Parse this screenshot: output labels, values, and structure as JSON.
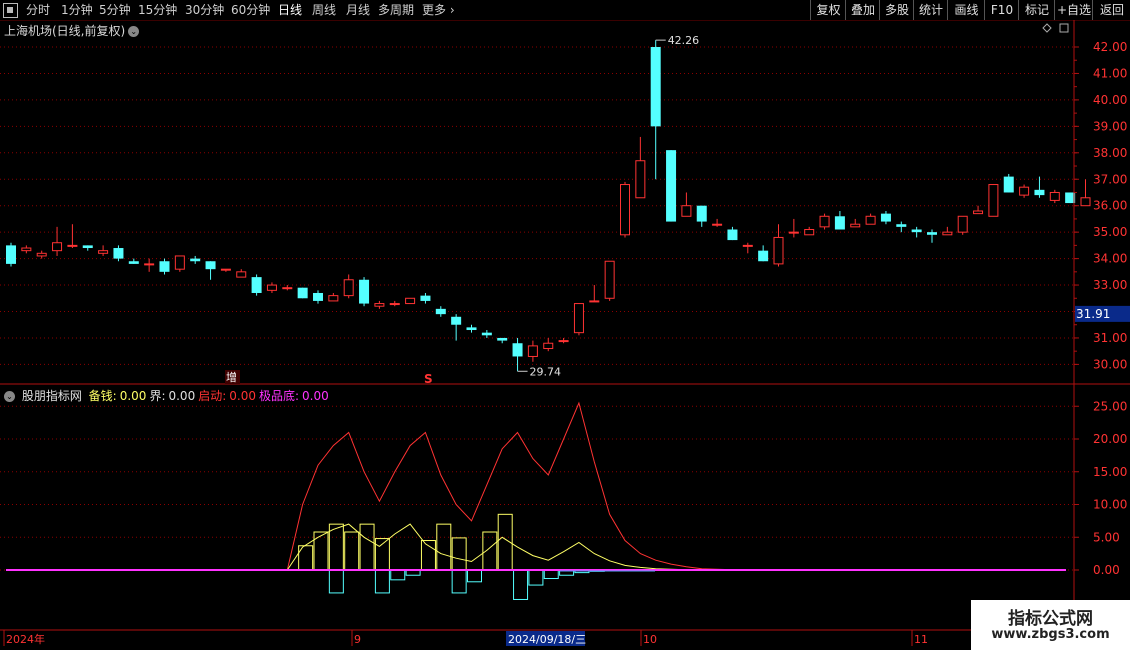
{
  "toolbar": {
    "periods": [
      "分时",
      "1分钟",
      "5分钟",
      "15分钟",
      "30分钟",
      "60分钟",
      "日线",
      "周线",
      "月线",
      "多周期",
      "更多"
    ],
    "active_period": "日线",
    "right_buttons": [
      "复权",
      "叠加",
      "多股",
      "统计",
      "画线",
      "F10",
      "标记",
      "+自选",
      "返回"
    ]
  },
  "main_chart": {
    "title": "上海机场(日线,前复权)",
    "price_ticks": [
      "42.00",
      "41.00",
      "40.00",
      "39.00",
      "38.00",
      "37.00",
      "36.00",
      "35.00",
      "34.00",
      "33.00",
      "32.00",
      "31.00",
      "30.00"
    ],
    "current_price": "31.91",
    "high_label": "42.26",
    "low_label": "29.74",
    "marker_zeng": "增",
    "marker_s": "S"
  },
  "indicator": {
    "name": "股朋指标网",
    "fields": [
      {
        "label": "备钱:",
        "value": "0.00",
        "color": "#ffff66"
      },
      {
        "label": "界:",
        "value": "0.00",
        "color": "#e0e0e0"
      },
      {
        "label": "启动:",
        "value": "0.00",
        "color": "#ff3333"
      },
      {
        "label": "极品底:",
        "value": "0.00",
        "color": "#ff33ff"
      }
    ],
    "ticks": [
      "25.00",
      "20.00",
      "15.00",
      "10.00",
      "5.00",
      "0.00"
    ]
  },
  "date_axis": {
    "labels": [
      "2024年",
      "9",
      "10",
      "11"
    ],
    "cursor_date": "2024/09/18/三"
  },
  "watermark": {
    "line1": "指标公式网",
    "line2": "www.zbgs3.com"
  },
  "colors": {
    "up": "#ff3333",
    "down": "#54ffff",
    "grid": "#8b0000",
    "axis": "#b01010"
  },
  "chart_data": {
    "type": "candlestick",
    "ylim": [
      29.3,
      42.8
    ],
    "candles": [
      [
        34.5,
        33.8,
        34.6,
        33.7
      ],
      [
        34.3,
        34.4,
        34.5,
        34.2
      ],
      [
        34.1,
        34.2,
        34.3,
        34.0
      ],
      [
        34.3,
        34.6,
        35.2,
        34.1
      ],
      [
        34.5,
        34.5,
        35.3,
        34.4
      ],
      [
        34.5,
        34.4,
        34.5,
        34.3
      ],
      [
        34.2,
        34.3,
        34.5,
        34.1
      ],
      [
        34.4,
        34.0,
        34.5,
        33.9
      ],
      [
        33.9,
        33.8,
        34.0,
        33.8
      ],
      [
        33.8,
        33.8,
        34.0,
        33.5
      ],
      [
        33.9,
        33.5,
        34.0,
        33.4
      ],
      [
        33.6,
        34.1,
        34.1,
        33.5
      ],
      [
        34.0,
        33.9,
        34.1,
        33.8
      ],
      [
        33.9,
        33.6,
        33.9,
        33.2
      ],
      [
        33.6,
        33.6,
        33.6,
        33.5
      ],
      [
        33.3,
        33.5,
        33.6,
        33.3
      ],
      [
        33.3,
        32.7,
        33.4,
        32.6
      ],
      [
        32.8,
        33.0,
        33.1,
        32.7
      ],
      [
        32.9,
        32.9,
        33.0,
        32.8
      ],
      [
        32.9,
        32.5,
        32.9,
        32.5
      ],
      [
        32.7,
        32.4,
        32.8,
        32.3
      ],
      [
        32.4,
        32.6,
        32.7,
        32.4
      ],
      [
        32.6,
        33.2,
        33.4,
        32.5
      ],
      [
        33.2,
        32.3,
        33.3,
        32.2
      ],
      [
        32.2,
        32.3,
        32.4,
        32.1
      ],
      [
        32.3,
        32.3,
        32.4,
        32.2
      ],
      [
        32.3,
        32.5,
        32.5,
        32.3
      ],
      [
        32.6,
        32.4,
        32.7,
        32.3
      ],
      [
        32.1,
        31.9,
        32.2,
        31.8
      ],
      [
        31.8,
        31.5,
        31.9,
        30.9
      ],
      [
        31.4,
        31.3,
        31.5,
        31.2
      ],
      [
        31.2,
        31.1,
        31.3,
        31.0
      ],
      [
        31.0,
        30.9,
        31.0,
        30.8
      ],
      [
        30.8,
        30.3,
        31.0,
        29.74
      ],
      [
        30.3,
        30.7,
        30.9,
        30.1
      ],
      [
        30.6,
        30.8,
        31.0,
        30.5
      ],
      [
        30.9,
        30.9,
        31.0,
        30.8
      ],
      [
        31.2,
        32.3,
        32.3,
        31.1
      ],
      [
        32.4,
        32.4,
        33.0,
        32.4
      ],
      [
        32.5,
        33.9,
        33.9,
        32.4
      ],
      [
        34.9,
        36.8,
        36.9,
        34.8
      ],
      [
        36.3,
        37.7,
        38.6,
        36.3
      ],
      [
        42.0,
        39.0,
        42.26,
        37.0
      ],
      [
        38.1,
        35.4,
        38.1,
        35.4
      ],
      [
        35.6,
        36.0,
        36.5,
        35.7
      ],
      [
        36.0,
        35.4,
        36.0,
        35.2
      ],
      [
        35.3,
        35.3,
        35.5,
        35.2
      ],
      [
        35.1,
        34.7,
        35.2,
        34.7
      ],
      [
        34.5,
        34.5,
        34.6,
        34.2
      ],
      [
        34.3,
        33.9,
        34.5,
        33.9
      ],
      [
        33.8,
        34.8,
        35.3,
        33.7
      ],
      [
        35.0,
        35.0,
        35.5,
        34.8
      ],
      [
        34.9,
        35.1,
        35.2,
        34.9
      ],
      [
        35.2,
        35.6,
        35.7,
        35.1
      ],
      [
        35.6,
        35.1,
        35.8,
        35.1
      ],
      [
        35.2,
        35.3,
        35.5,
        35.2
      ],
      [
        35.3,
        35.6,
        35.7,
        35.3
      ],
      [
        35.7,
        35.4,
        35.8,
        35.3
      ],
      [
        35.3,
        35.2,
        35.4,
        35.0
      ],
      [
        35.1,
        35.0,
        35.2,
        34.8
      ],
      [
        35.0,
        34.9,
        35.1,
        34.6
      ],
      [
        34.9,
        35.0,
        35.2,
        34.9
      ],
      [
        35.0,
        35.6,
        35.6,
        34.9
      ],
      [
        35.7,
        35.8,
        36.0,
        35.7
      ],
      [
        35.6,
        36.8,
        36.8,
        35.6
      ],
      [
        37.1,
        36.5,
        37.2,
        36.5
      ],
      [
        36.4,
        36.7,
        36.8,
        36.3
      ],
      [
        36.6,
        36.4,
        37.1,
        36.3
      ],
      [
        36.2,
        36.5,
        36.6,
        36.1
      ],
      [
        36.5,
        36.1,
        36.5,
        36.1
      ],
      [
        36.0,
        36.3,
        37.0,
        36.0
      ]
    ],
    "indicator": {
      "qidong": [
        0,
        0,
        0,
        0,
        0,
        0,
        0,
        0,
        0,
        0,
        0,
        0,
        0,
        0,
        0,
        0,
        0,
        0,
        0,
        10.0,
        16.0,
        19.0,
        21.0,
        15.0,
        10.5,
        15.0,
        19.0,
        21.0,
        14.5,
        10.0,
        7.5,
        13.0,
        18.5,
        21.0,
        17.0,
        14.5,
        20.0,
        25.5,
        16.5,
        8.5,
        4.5,
        2.5,
        1.5,
        0.9,
        0.5,
        0.2,
        0.1,
        0.05,
        0.02,
        0.01,
        0,
        0,
        0,
        0,
        0,
        0,
        0,
        0,
        0,
        0,
        0,
        0,
        0,
        0,
        0,
        0,
        0,
        0,
        0,
        0,
        0
      ],
      "beiqian": [
        0,
        0,
        0,
        0,
        0,
        0,
        0,
        0,
        0,
        0,
        0,
        0,
        0,
        0,
        0,
        0,
        0,
        0,
        0,
        3.5,
        5.0,
        6.2,
        7.0,
        5.0,
        3.6,
        5.5,
        7.0,
        4.0,
        2.5,
        1.8,
        1.3,
        3.0,
        5.0,
        3.5,
        2.2,
        1.5,
        2.8,
        4.2,
        2.5,
        1.4,
        0.7,
        0.4,
        0.2,
        0.1,
        0.05,
        0.02,
        0.01,
        0,
        0,
        0,
        0,
        0,
        0,
        0,
        0,
        0,
        0,
        0,
        0,
        0,
        0,
        0,
        0,
        0,
        0,
        0,
        0,
        0,
        0,
        0,
        0
      ],
      "bars_pos": [
        [
          19,
          3.7
        ],
        [
          20,
          5.8
        ],
        [
          21,
          7.0
        ],
        [
          22,
          5.8
        ],
        [
          23,
          7.0
        ],
        [
          24,
          4.8
        ],
        [
          27,
          4.5
        ],
        [
          28,
          7.0
        ],
        [
          29,
          4.9
        ],
        [
          31,
          5.8
        ],
        [
          32,
          8.5
        ]
      ],
      "bars_neg": [
        [
          21,
          -3.5
        ],
        [
          24,
          -3.5
        ],
        [
          25,
          -1.5
        ],
        [
          26,
          -0.8
        ],
        [
          29,
          -3.5
        ],
        [
          30,
          -1.8
        ],
        [
          33,
          -4.5
        ],
        [
          34,
          -2.3
        ],
        [
          35,
          -1.3
        ],
        [
          36,
          -0.8
        ],
        [
          37,
          -0.4
        ],
        [
          38,
          -0.2
        ],
        [
          39,
          -0.1
        ],
        [
          40,
          -0.05
        ],
        [
          41,
          -0.02
        ]
      ]
    }
  }
}
